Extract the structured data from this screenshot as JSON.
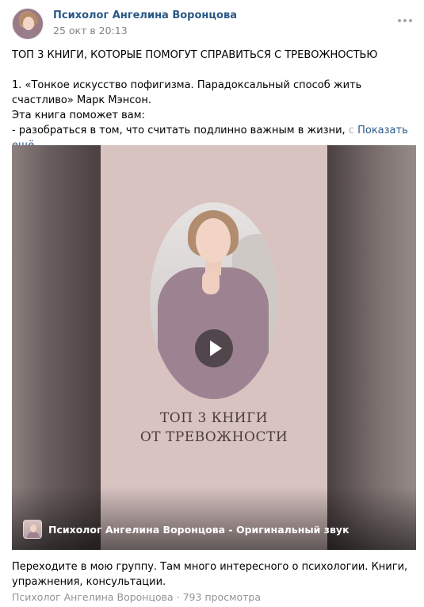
{
  "post": {
    "author": "Психолог Ангелина Воронцова",
    "date": "25 окт в 20:13",
    "text": {
      "title": "ТОП 3 КНИГИ, КОТОРЫЕ ПОМОГУТ СПРАВИТЬСЯ С ТРЕВОЖНОСТЬЮ",
      "book_line": "1. «Тонкое искусство пофигизма. Парадоксальный способ жить счастливо» Марк Мэнсон.",
      "helps_line": "Эта книга поможет вам:",
      "bullet_line": "- разобраться в том, что считать подлинно важным в жизни,",
      "bullet_faded": " с",
      "show_more": "Показать ещё"
    }
  },
  "video": {
    "title_line1": "ТОП 3 КНИГИ",
    "title_line2": "ОТ ТРЕВОЖНОСТИ",
    "caption": "Психолог Ангелина Воронцова - Оригинальный звук"
  },
  "footer": {
    "description": "Переходите в мою группу. Там много интересного о психологии. Книги, упражнения, консультации.",
    "source": "Психолог Ангелина Воронцова",
    "separator": " · ",
    "views": "793 просмотра"
  },
  "icons": {
    "more": "more-horizontal-icon",
    "play": "play-icon"
  }
}
